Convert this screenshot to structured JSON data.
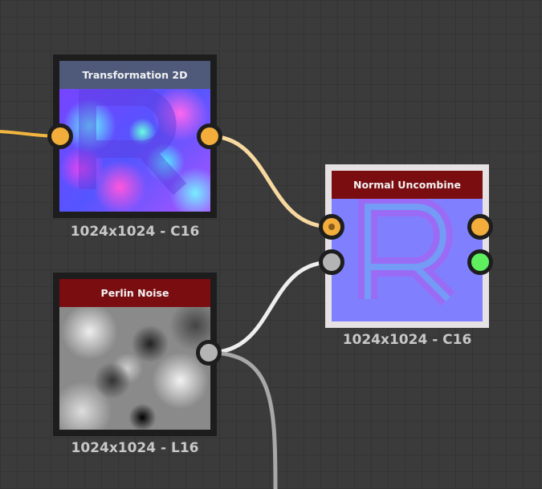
{
  "nodes": {
    "transformation": {
      "title": "Transformation 2D",
      "resolution": "1024x1024 - C16",
      "header_color": "#4f5a7b"
    },
    "normal_uncombine": {
      "title": "Normal Uncombine",
      "resolution": "1024x1024 - C16",
      "header_color": "#7a0d10"
    },
    "perlin": {
      "title": "Perlin Noise",
      "resolution": "1024x1024 - L16",
      "header_color": "#7a0d10"
    }
  },
  "colors": {
    "port_color": "#f2ad3a",
    "port_gray": "#b4b4b4",
    "port_green": "#5ef05e",
    "normal_base": "#8080ff"
  }
}
